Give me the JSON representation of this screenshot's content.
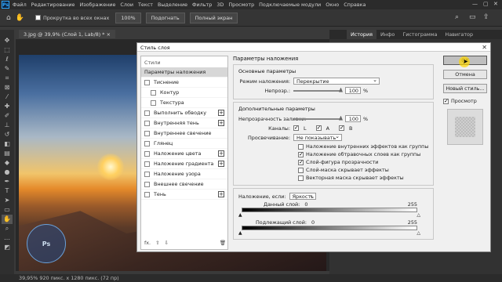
{
  "app": {
    "logo": "Ps"
  },
  "menubar": {
    "items": [
      "Файл",
      "Редактирование",
      "Изображение",
      "Слои",
      "Текст",
      "Выделение",
      "Фильтр",
      "3D",
      "Просмотр",
      "Подключаемые модули",
      "Окно",
      "Справка"
    ]
  },
  "options": {
    "scroll_all_windows": "Прокрутка во всех окнах",
    "zoom_value": "100%",
    "fit_label": "Подогнать",
    "fullscreen_label": "Полный экран"
  },
  "document": {
    "tab": "3.jpg @ 39,9% (Слой 1, Lab/8) *",
    "status": "39,95%  920 пикс. x 1280 пикс. (72 пр)"
  },
  "panels": {
    "tabs": [
      "История",
      "Инфо",
      "Гистограмма",
      "Навигатор"
    ]
  },
  "dialog": {
    "title": "Стиль слоя",
    "styles_header": "Стили",
    "styles": [
      {
        "label": "Параметры наложения",
        "checkbox": false,
        "plus": false,
        "selected": true,
        "indent": false
      },
      {
        "label": "Тиснение",
        "checkbox": true,
        "plus": false,
        "selected": false,
        "indent": false
      },
      {
        "label": "Контур",
        "checkbox": true,
        "plus": false,
        "selected": false,
        "indent": true
      },
      {
        "label": "Текстура",
        "checkbox": true,
        "plus": false,
        "selected": false,
        "indent": true
      },
      {
        "label": "Выполнить обводку",
        "checkbox": true,
        "plus": true,
        "selected": false,
        "indent": false
      },
      {
        "label": "Внутренняя тень",
        "checkbox": true,
        "plus": true,
        "selected": false,
        "indent": false
      },
      {
        "label": "Внутреннее свечение",
        "checkbox": true,
        "plus": false,
        "selected": false,
        "indent": false
      },
      {
        "label": "Глянец",
        "checkbox": true,
        "plus": false,
        "selected": false,
        "indent": false
      },
      {
        "label": "Наложение цвета",
        "checkbox": true,
        "plus": true,
        "selected": false,
        "indent": false
      },
      {
        "label": "Наложение градиента",
        "checkbox": true,
        "plus": true,
        "selected": false,
        "indent": false
      },
      {
        "label": "Наложение узора",
        "checkbox": true,
        "plus": false,
        "selected": false,
        "indent": false
      },
      {
        "label": "Внешнее свечение",
        "checkbox": true,
        "plus": false,
        "selected": false,
        "indent": false
      },
      {
        "label": "Тень",
        "checkbox": true,
        "plus": true,
        "selected": false,
        "indent": false
      }
    ],
    "footer_fx": "fx.",
    "blending": {
      "title": "Параметры наложения",
      "general_title": "Основные параметры",
      "mode_label": "Режим наложения:",
      "mode_value": "Перекрытие",
      "opacity_label": "Непрозр.:",
      "opacity_value": "100",
      "percent": "%",
      "advanced_title": "Дополнительные параметры",
      "fill_label": "Непрозрачность заливки:",
      "fill_value": "100",
      "channels_label": "Каналы:",
      "channels": [
        "L",
        "A",
        "B"
      ],
      "knockout_label": "Просвечивание:",
      "knockout_value": "Не показывать",
      "options": [
        {
          "label": "Наложение внутренних эффектов как группы",
          "checked": false
        },
        {
          "label": "Наложение обтравочных слоев как группы",
          "checked": true
        },
        {
          "label": "Слой-фигура прозрачности",
          "checked": true
        },
        {
          "label": "Слой-маска скрывает эффекты",
          "checked": false
        },
        {
          "label": "Векторная маска скрывает эффекты",
          "checked": false
        }
      ],
      "blend_if_label": "Наложение, если:",
      "blend_if_value": "Яркость",
      "this_layer_label": "Данный слой:",
      "this_layer_min": "0",
      "this_layer_max": "255",
      "underlying_label": "Подлежащий слой:",
      "underlying_min": "0",
      "underlying_max": "255"
    },
    "buttons": {
      "ok": "ОК",
      "cancel": "Отмена",
      "new_style": "Новый стиль...",
      "preview": "Просмотр"
    }
  }
}
